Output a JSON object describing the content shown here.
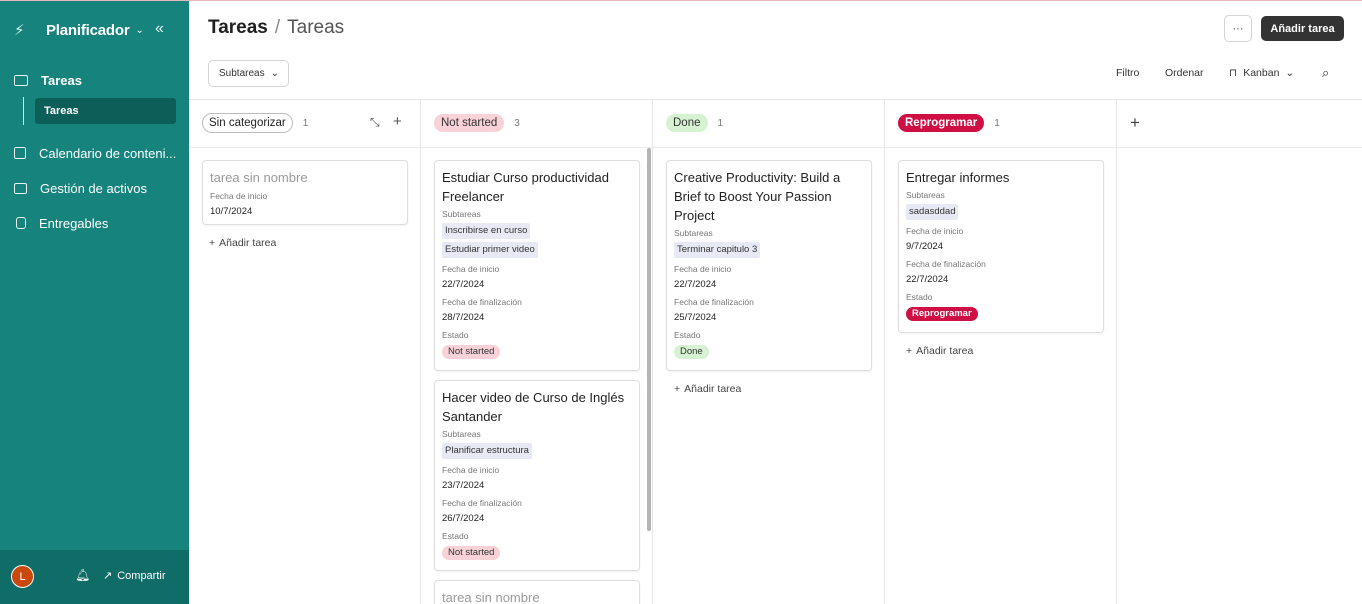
{
  "sidebar": {
    "app_name": "Planificador",
    "items": [
      {
        "label": "Tareas",
        "icon": "folder-icon"
      },
      {
        "label": "Calendario de conteni...",
        "icon": "calendar-icon"
      },
      {
        "label": "Gestión de activos",
        "icon": "image-icon"
      },
      {
        "label": "Entregables",
        "icon": "document-icon"
      }
    ],
    "subitem": "Tareas",
    "avatar_initial": "L",
    "share_label": "Compartir"
  },
  "header": {
    "title": "Tareas",
    "separator": "/",
    "subtitle": "Tareas",
    "more_label": "···",
    "add_task_label": "Añadir tarea"
  },
  "toolbar": {
    "subtasks_dropdown": "Subtareas",
    "filter": "Filtro",
    "sort": "Ordenar",
    "view": "Kanban"
  },
  "columns": [
    {
      "name": "Sin categorizar",
      "count": "1",
      "cards": [
        {
          "title": "tarea sin nombre",
          "start_label": "Fecha de inicio",
          "start": "10/7/2024"
        }
      ],
      "add_label": "Añadir tarea"
    },
    {
      "name": "Not started",
      "count": "3",
      "cards": [
        {
          "title": "Estudiar Curso productividad Freelancer",
          "subtasks_label": "Subtareas",
          "subtasks": [
            "Inscribirse en curso",
            "Estudiar primer video"
          ],
          "start_label": "Fecha de inicio",
          "start": "22/7/2024",
          "end_label": "Fecha de finalización",
          "end": "28/7/2024",
          "status_label": "Estado",
          "status": "Not started"
        },
        {
          "title": "Hacer video de Curso de Inglés Santander",
          "subtasks_label": "Subtareas",
          "subtasks": [
            "Planificar estructura"
          ],
          "start_label": "Fecha de inicio",
          "start": "23/7/2024",
          "end_label": "Fecha de finalización",
          "end": "26/7/2024",
          "status_label": "Estado",
          "status": "Not started"
        },
        {
          "title": "tarea sin nombre"
        }
      ]
    },
    {
      "name": "Done",
      "count": "1",
      "cards": [
        {
          "title": "Creative Productivity: Build a Brief to Boost Your Passion Project",
          "subtasks_label": "Subtareas",
          "subtasks": [
            "Terminar capitulo 3"
          ],
          "start_label": "Fecha de inicio",
          "start": "22/7/2024",
          "end_label": "Fecha de finalización",
          "end": "25/7/2024",
          "status_label": "Estado",
          "status": "Done"
        }
      ],
      "add_label": "Añadir tarea"
    },
    {
      "name": "Reprogramar",
      "count": "1",
      "cards": [
        {
          "title": "Entregar informes",
          "subtasks_label": "Subtareas",
          "subtasks": [
            "sadasddad"
          ],
          "start_label": "Fecha de inicio",
          "start": "9/7/2024",
          "end_label": "Fecha de finalización",
          "end": "22/7/2024",
          "status_label": "Estado",
          "status": "Reprogramar"
        }
      ],
      "add_label": "Añadir tarea"
    }
  ],
  "colors": {
    "sidebar": "#16837c",
    "not_started": "#f8d2d8",
    "done": "#d6f2d2",
    "reprogramar": "#cf0f44"
  }
}
